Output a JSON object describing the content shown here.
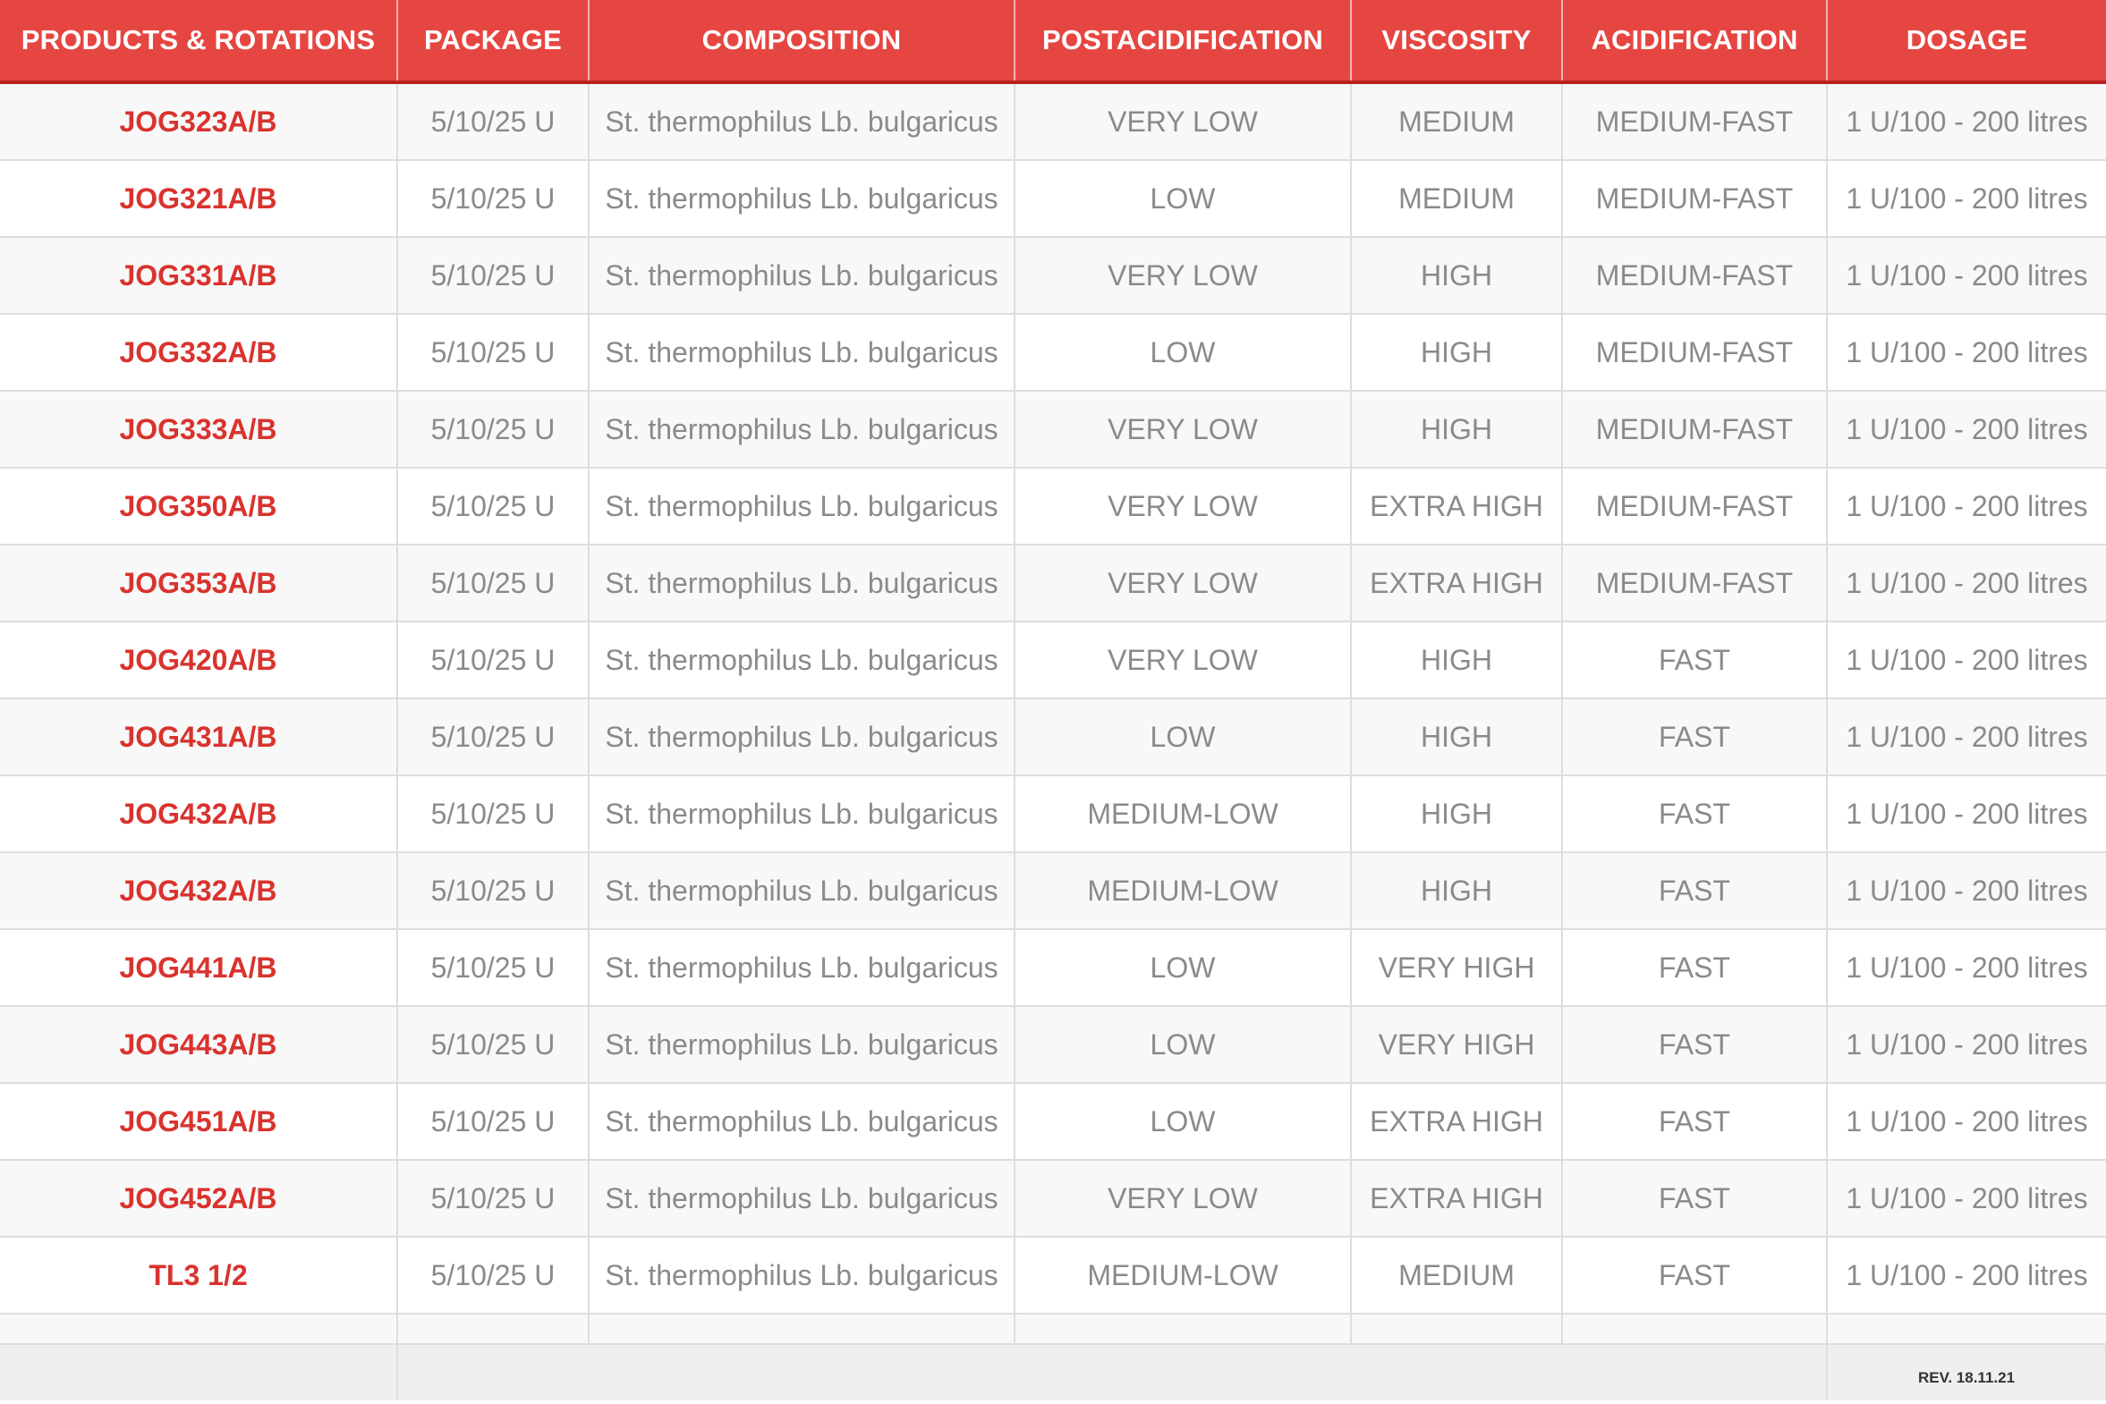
{
  "colors": {
    "header_bg": "#e64641",
    "header_text": "#ffffff",
    "product_text": "#d9332e",
    "cell_text": "#8a8a8a",
    "row_alt_bg": "#f8f8f8",
    "footer_bg": "#efefef"
  },
  "table": {
    "headers": {
      "products": "PRODUCTS & ROTATIONS",
      "package": "PACKAGE",
      "composition": "COMPOSITION",
      "postacidification": "POSTACIDIFICATION",
      "viscosity": "VISCOSITY",
      "acidification": "ACIDIFICATION",
      "dosage": "DOSAGE"
    },
    "rows": [
      {
        "product": "JOG323A/B",
        "package": "5/10/25 U",
        "composition": "St. thermophilus Lb. bulgaricus",
        "postacidification": "VERY LOW",
        "viscosity": "MEDIUM",
        "acidification": "MEDIUM-FAST",
        "dosage": "1 U/100 - 200 litres"
      },
      {
        "product": "JOG321A/B",
        "package": "5/10/25 U",
        "composition": "St. thermophilus Lb. bulgaricus",
        "postacidification": "LOW",
        "viscosity": "MEDIUM",
        "acidification": "MEDIUM-FAST",
        "dosage": "1 U/100 - 200 litres"
      },
      {
        "product": "JOG331A/B",
        "package": "5/10/25 U",
        "composition": "St. thermophilus Lb. bulgaricus",
        "postacidification": "VERY LOW",
        "viscosity": "HIGH",
        "acidification": "MEDIUM-FAST",
        "dosage": "1 U/100 - 200 litres"
      },
      {
        "product": "JOG332A/B",
        "package": "5/10/25 U",
        "composition": "St. thermophilus Lb. bulgaricus",
        "postacidification": "LOW",
        "viscosity": "HIGH",
        "acidification": "MEDIUM-FAST",
        "dosage": "1 U/100 - 200 litres"
      },
      {
        "product": "JOG333A/B",
        "package": "5/10/25 U",
        "composition": "St. thermophilus Lb. bulgaricus",
        "postacidification": "VERY LOW",
        "viscosity": "HIGH",
        "acidification": "MEDIUM-FAST",
        "dosage": "1 U/100 - 200 litres"
      },
      {
        "product": "JOG350A/B",
        "package": "5/10/25 U",
        "composition": "St. thermophilus Lb. bulgaricus",
        "postacidification": "VERY LOW",
        "viscosity": "EXTRA HIGH",
        "acidification": "MEDIUM-FAST",
        "dosage": "1 U/100 - 200 litres"
      },
      {
        "product": "JOG353A/B",
        "package": "5/10/25 U",
        "composition": "St. thermophilus Lb. bulgaricus",
        "postacidification": "VERY LOW",
        "viscosity": "EXTRA HIGH",
        "acidification": "MEDIUM-FAST",
        "dosage": "1 U/100 - 200 litres"
      },
      {
        "product": "JOG420A/B",
        "package": "5/10/25 U",
        "composition": "St. thermophilus Lb. bulgaricus",
        "postacidification": "VERY LOW",
        "viscosity": "HIGH",
        "acidification": "FAST",
        "dosage": "1 U/100 - 200 litres"
      },
      {
        "product": "JOG431A/B",
        "package": "5/10/25 U",
        "composition": "St. thermophilus Lb. bulgaricus",
        "postacidification": "LOW",
        "viscosity": "HIGH",
        "acidification": "FAST",
        "dosage": "1 U/100 - 200 litres"
      },
      {
        "product": "JOG432A/B",
        "package": "5/10/25 U",
        "composition": "St. thermophilus Lb. bulgaricus",
        "postacidification": "MEDIUM-LOW",
        "viscosity": "HIGH",
        "acidification": "FAST",
        "dosage": "1 U/100 - 200 litres"
      },
      {
        "product": "JOG432A/B",
        "package": "5/10/25 U",
        "composition": "St. thermophilus Lb. bulgaricus",
        "postacidification": "MEDIUM-LOW",
        "viscosity": "HIGH",
        "acidification": "FAST",
        "dosage": "1 U/100 - 200 litres"
      },
      {
        "product": "JOG441A/B",
        "package": "5/10/25 U",
        "composition": "St. thermophilus Lb. bulgaricus",
        "postacidification": "LOW",
        "viscosity": "VERY HIGH",
        "acidification": "FAST",
        "dosage": "1 U/100 - 200 litres"
      },
      {
        "product": "JOG443A/B",
        "package": "5/10/25 U",
        "composition": "St. thermophilus Lb. bulgaricus",
        "postacidification": "LOW",
        "viscosity": "VERY HIGH",
        "acidification": "FAST",
        "dosage": "1 U/100 - 200 litres"
      },
      {
        "product": "JOG451A/B",
        "package": "5/10/25 U",
        "composition": "St. thermophilus Lb. bulgaricus",
        "postacidification": "LOW",
        "viscosity": "EXTRA HIGH",
        "acidification": "FAST",
        "dosage": "1 U/100 - 200 litres"
      },
      {
        "product": "JOG452A/B",
        "package": "5/10/25 U",
        "composition": "St. thermophilus Lb. bulgaricus",
        "postacidification": "VERY LOW",
        "viscosity": "EXTRA HIGH",
        "acidification": "FAST",
        "dosage": "1 U/100 - 200 litres"
      },
      {
        "product": "TL3 1/2",
        "package": "5/10/25 U",
        "composition": "St. thermophilus Lb. bulgaricus",
        "postacidification": "MEDIUM-LOW",
        "viscosity": "MEDIUM",
        "acidification": "FAST",
        "dosage": "1 U/100 - 200 litres"
      }
    ],
    "footer": {
      "revision": "REV. 18.11.21"
    }
  }
}
